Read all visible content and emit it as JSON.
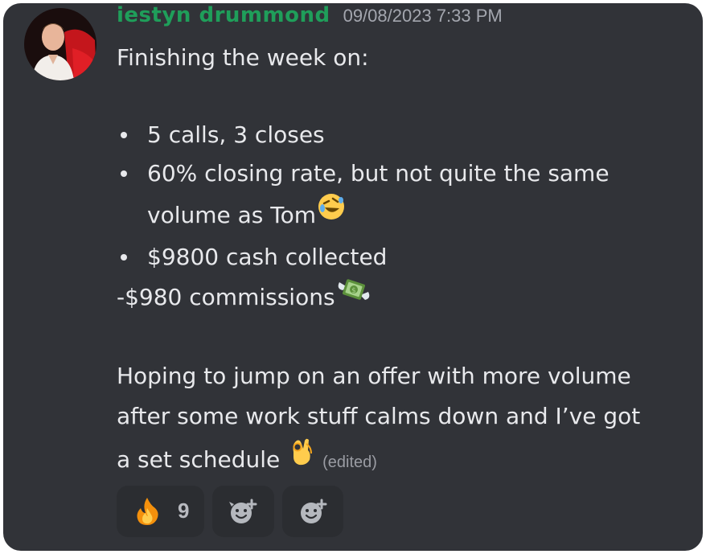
{
  "message": {
    "author": "iestyn drummond",
    "timestamp": "09/08/2023 7:33 PM",
    "intro": "Finishing the week on:",
    "bullets": [
      "5 calls, 3 closes",
      "60% closing rate, but not quite the same",
      "volume as Tom",
      "$9800 cash collected"
    ],
    "commission_line": "-$980 commissions",
    "para_lines": [
      "Hoping to jump on an offer with more volume",
      "after some work stuff calms down and I’ve got",
      "a set schedule "
    ],
    "edited_label": "(edited)",
    "emojis": {
      "tom": "rolling-on-floor-laughing",
      "commissions": "money-with-wings",
      "schedule": "ok-hand"
    }
  },
  "reactions": [
    {
      "emoji": "fire",
      "count": "9"
    },
    {
      "icon": "add-reaction-icon"
    },
    {
      "icon": "add-super-reaction-icon"
    }
  ],
  "colors": {
    "background": "#313338",
    "username": "#1f9e5a",
    "timestamp": "#a3a6ae",
    "text": "#e8e9ec",
    "reaction_bg": "#2b2d31"
  }
}
